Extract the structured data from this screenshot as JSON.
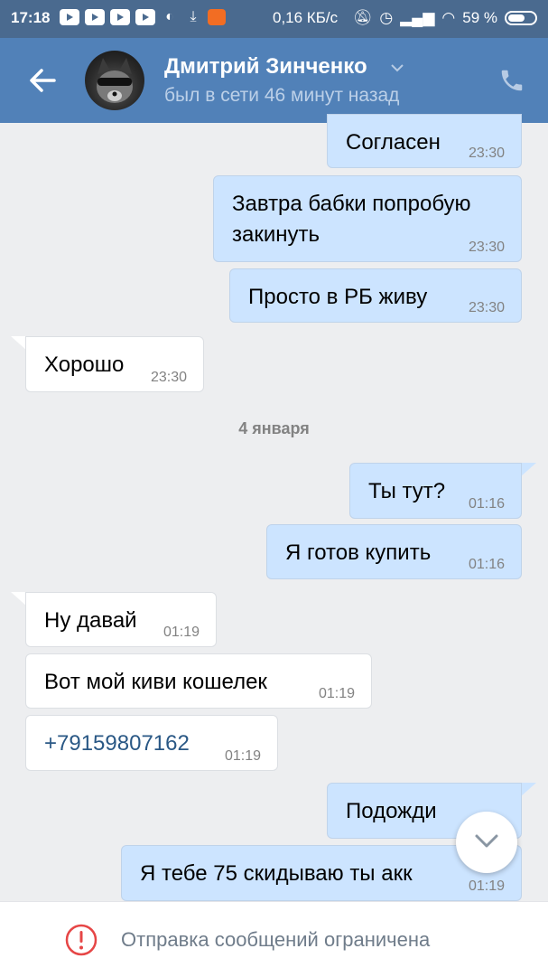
{
  "statusbar": {
    "time": "17:18",
    "speed": "0,16 КБ/с",
    "battery": "59 %"
  },
  "header": {
    "name": "Дмитрий Зинченко",
    "status": "был в сети 46 минут назад"
  },
  "messages": [
    {
      "dir": "out",
      "text": "Согласен",
      "time": "23:30"
    },
    {
      "dir": "out",
      "text": "Завтра бабки попробую",
      "text2": "закинуть",
      "time": "23:30"
    },
    {
      "dir": "out",
      "text": "Просто в РБ живу",
      "time": "23:30"
    },
    {
      "dir": "in",
      "text": "Хорошо",
      "time": "23:30"
    },
    {
      "dir": "out",
      "text": "Ты тут?",
      "time": "01:16"
    },
    {
      "dir": "out",
      "text": "Я готов купить",
      "time": "01:16"
    },
    {
      "dir": "in",
      "text": "Ну давай",
      "time": "01:19"
    },
    {
      "dir": "in",
      "text": "Вот мой киви кошелек",
      "time": "01:19"
    },
    {
      "dir": "in",
      "text": "+79159807162",
      "time": "01:19"
    },
    {
      "dir": "out",
      "text": "Подожди",
      "time": ""
    },
    {
      "dir": "out",
      "text": "Я тебе 75 скидываю ты акк",
      "time": "01:19"
    }
  ],
  "date_separator": "4 января",
  "bottom": {
    "label": "Отправка сообщений ограничена"
  },
  "colors": {
    "header": "#5181b8",
    "outgoing": "#cce4ff",
    "incoming": "#ffffff",
    "warning": "#e64646"
  }
}
